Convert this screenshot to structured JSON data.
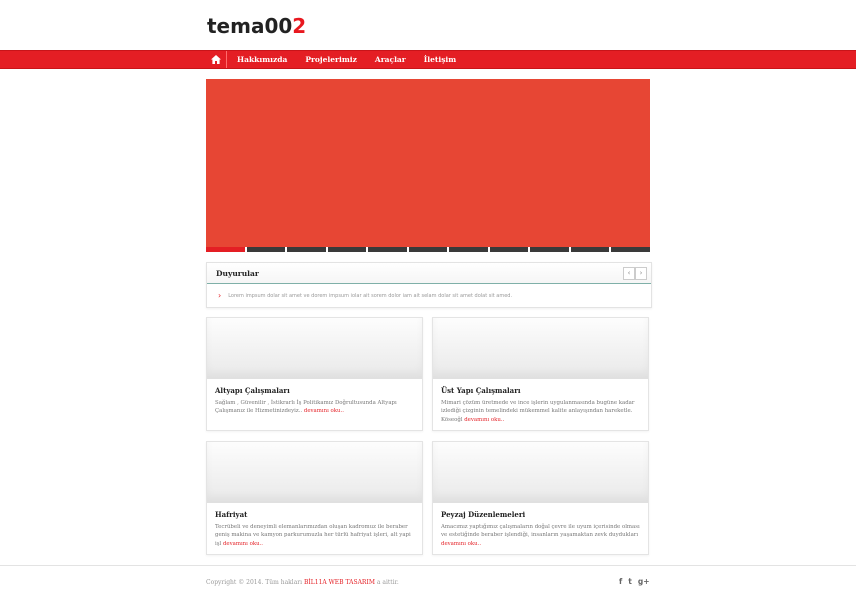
{
  "logo": {
    "main": "tema00",
    "accent": "2"
  },
  "nav": {
    "home_icon": "home-icon",
    "items": [
      "Hakkımızda",
      "Projelerimiz",
      "Araçlar",
      "İletişim"
    ]
  },
  "slider": {
    "background": "#e74634",
    "active_color": "#e41e24",
    "dot_count": 11,
    "active_index": 0
  },
  "announcements": {
    "title": "Duyurular",
    "prev_label": "‹",
    "next_label": "›",
    "text": "Lorem impsum dolar sit amet ve dorem impsum iolar ait sorem dolor iam ait selam dolar sit amet dolat sit amed."
  },
  "cards": [
    {
      "title": "Altyapı Çalışmaları",
      "text": "Sağlam , Güvenilir , İstikrarlı İş Politikamız Doğrultusunda Altyapı Çalışmanız ile Hizmetinizdeyiz..",
      "more": "devamını oku.."
    },
    {
      "title": "Üst Yapı Çalışmaları",
      "text": "Mimari çözüm üretmede ve ince işlerin uygulanmasında bugüne kadar izlediği çizginin temelindeki mükemmel kalite anlayışından hareketle. Köseoğl",
      "more": "devamını oku.."
    },
    {
      "title": "Hafriyat",
      "text": "Tecrübeli ve deneyimli elemanlarımızdan oluşan kadromuz ile beraber geniş makina ve kamyon parkurumuzla her türlü hafriyat işleri, alt yapi işl",
      "more": "devamını oku.."
    },
    {
      "title": "Peyzaj Düzenlemeleri",
      "text": "Amacımız yaptığımız çalışmaların doğal çevre ile uyum içerisinde olması ve estetiğinde beraber işlendiği, insanların yaşamaktan zevk duydukları",
      "more": "devamını oku.."
    }
  ],
  "footer": {
    "copy_prefix": "Copyright © 2014. Tüm hakları",
    "brand": "BİL11A WEB TASARIM",
    "copy_suffix": "a aittir.",
    "social": [
      "f",
      "t",
      "g+"
    ]
  }
}
